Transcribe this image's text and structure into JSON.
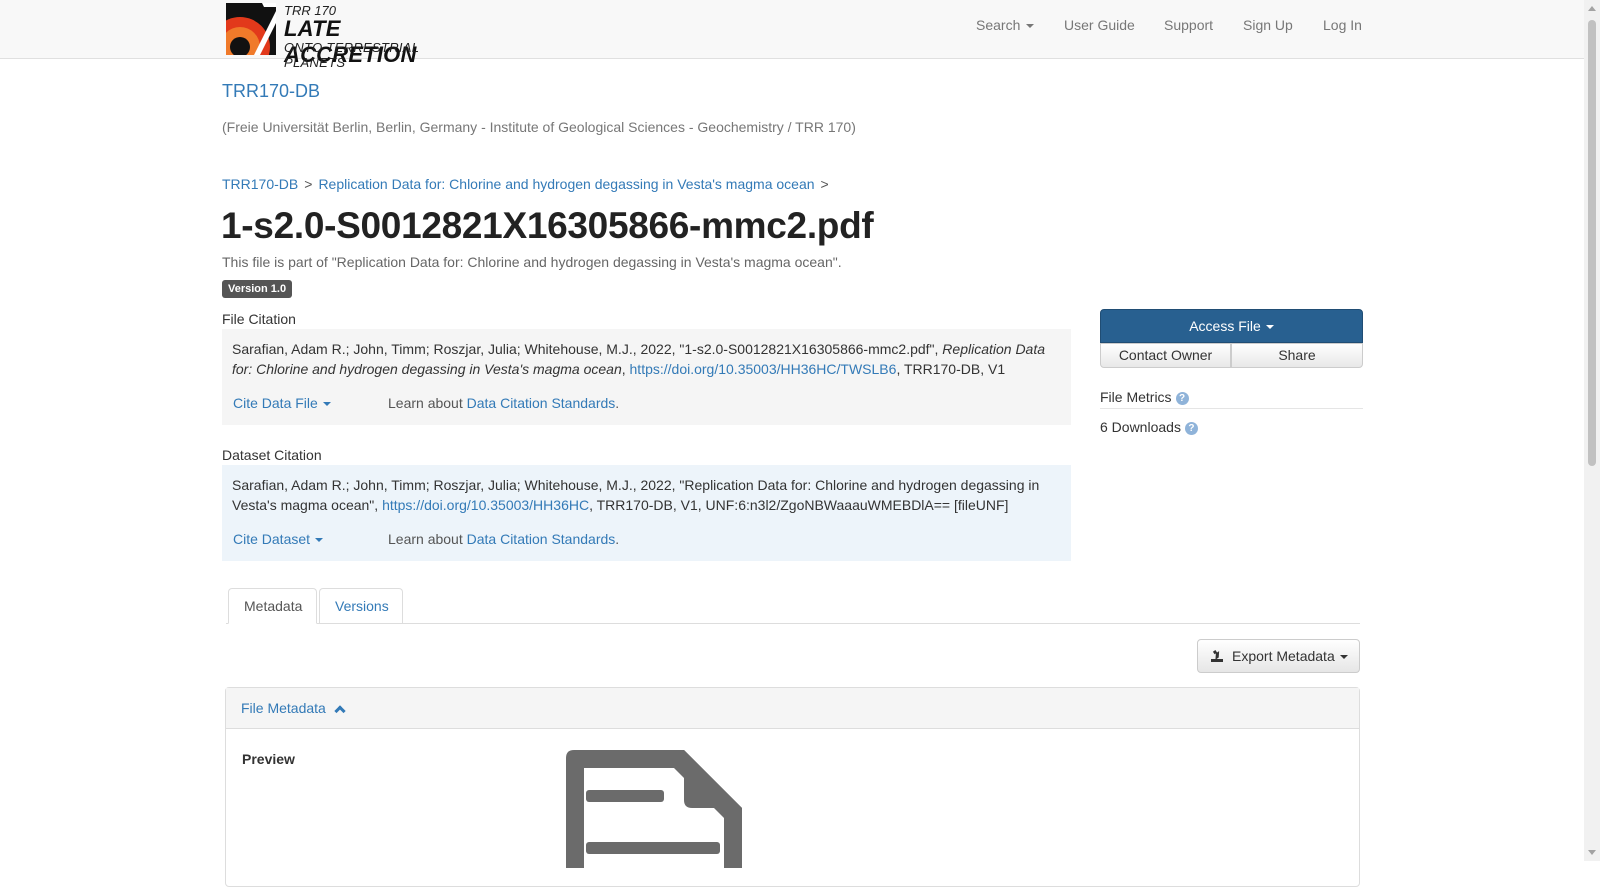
{
  "logo": {
    "line1": "TRR 170",
    "line2": "LATE ACCRETION",
    "line3": "ONTO TERRESTRIAL PLANETS"
  },
  "nav": {
    "search": "Search",
    "user_guide": "User Guide",
    "support": "Support",
    "sign_up": "Sign Up",
    "log_in": "Log In"
  },
  "dataverse": {
    "title": "TRR170-DB",
    "affiliation": "(Freie Universität Berlin, Berlin, Germany - Institute of Geological Sciences - Geochemistry / TRR 170)"
  },
  "breadcrumb": {
    "root": "TRR170-DB",
    "separator": ">",
    "dataset": "Replication Data for: Chlorine and hydrogen degassing in Vesta's magma ocean"
  },
  "file": {
    "title": "1-s2.0-S0012821X16305866-mmc2.pdf",
    "subtitle": "This file is part of \"Replication Data for: Chlorine and hydrogen degassing in Vesta's magma ocean\".",
    "version": "Version 1.0"
  },
  "file_citation": {
    "label": "File Citation",
    "authors": "Sarafian, Adam R.; John, Timm; Roszjar, Julia; Whitehouse, M.J., 2022, \"1-s2.0-S0012821X16305866-mmc2.pdf\", ",
    "title_italic": "Replication Data for: Chlorine and hydrogen degassing in Vesta's magma ocean",
    "sep": ", ",
    "doi": "https://doi.org/10.35003/HH36HC/TWSLB6",
    "tail": ", TRR170-DB, V1",
    "cite_button": "Cite Data File",
    "learn_prefix": "Learn about ",
    "learn_link": "Data Citation Standards",
    "learn_suffix": "."
  },
  "dataset_citation": {
    "label": "Dataset Citation",
    "authors": "Sarafian, Adam R.; John, Timm; Roszjar, Julia; Whitehouse, M.J., 2022, \"Replication Data for: Chlorine and hydrogen degassing in Vesta's magma ocean\", ",
    "doi": "https://doi.org/10.35003/HH36HC",
    "tail": ", TRR170-DB, V1, UNF:6:n3l2/ZgoNBWaaauWMEBDlA== [fileUNF]",
    "cite_button": "Cite Dataset",
    "learn_prefix": "Learn about ",
    "learn_link": "Data Citation Standards",
    "learn_suffix": "."
  },
  "sidebar": {
    "access_file": "Access File",
    "contact_owner": "Contact Owner",
    "share": "Share",
    "file_metrics": "File Metrics",
    "downloads": "6 Downloads",
    "help_glyph": "?"
  },
  "tabs": {
    "metadata": "Metadata",
    "versions": "Versions"
  },
  "export": {
    "label": "Export Metadata"
  },
  "file_metadata": {
    "heading": "File Metadata",
    "preview_label": "Preview"
  },
  "colors": {
    "link": "#337ab7",
    "primary_button": "#286090",
    "file_citation_bg": "#f5f5f5",
    "dataset_citation_bg": "#edf4fa",
    "version_badge": "#555555",
    "logo_red": "#e2391b"
  },
  "icons": {
    "help": "question-circle-icon",
    "export": "export-icon",
    "collapse": "chevron-up-icon",
    "preview": "file-document-icon"
  }
}
